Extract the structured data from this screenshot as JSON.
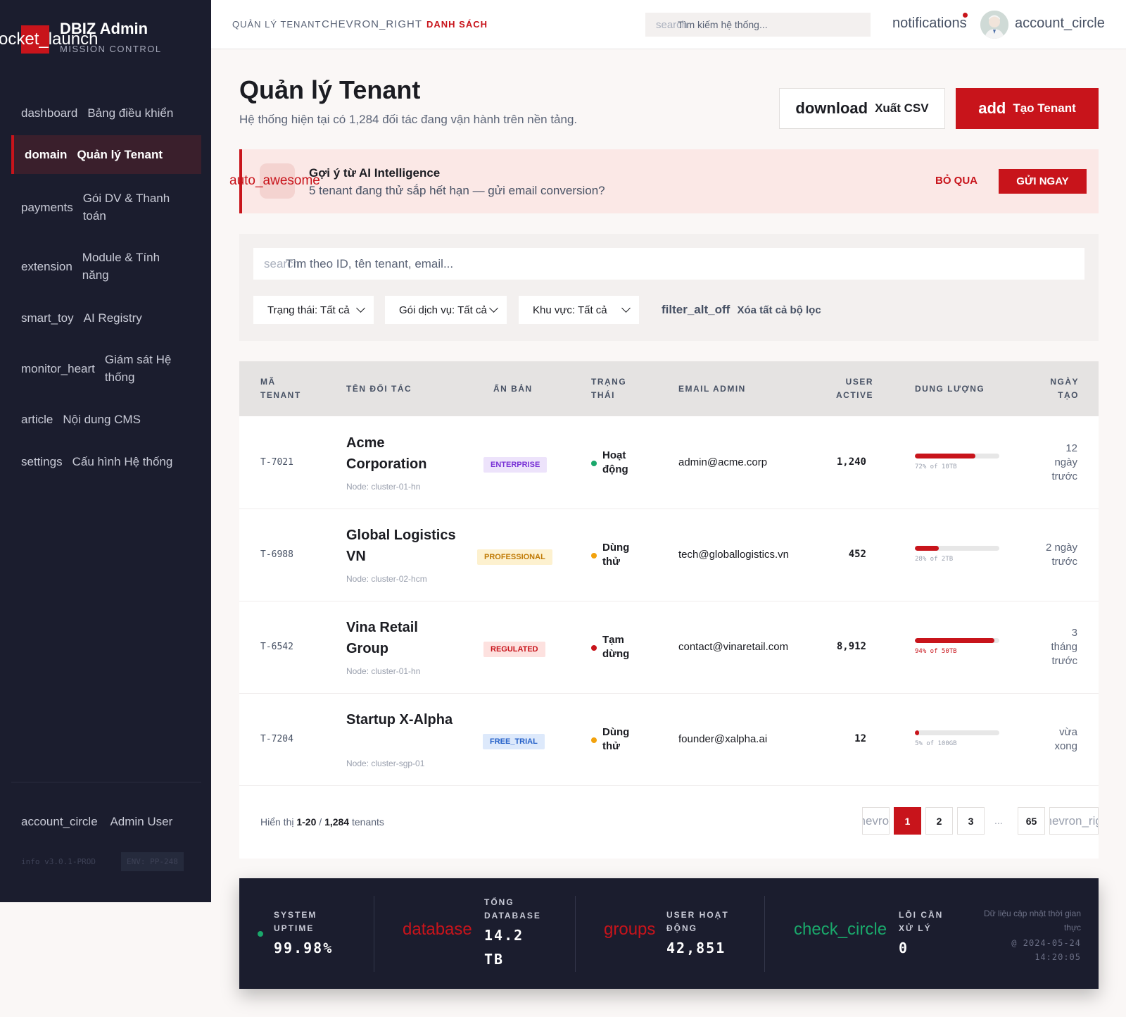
{
  "sidebar": {
    "logo_icon": "rocket_launch",
    "brand_title": "DBIZ Admin",
    "brand_subtitle": "MISSION CONTROL",
    "items": [
      {
        "icon": "dashboard",
        "label": "Bảng điều khiển"
      },
      {
        "icon": "domain",
        "label": "Quản lý Tenant"
      },
      {
        "icon": "payments",
        "label": "Gói DV & Thanh toán"
      },
      {
        "icon": "extension",
        "label": "Module & Tính năng"
      },
      {
        "icon": "smart_toy",
        "label": "AI Registry"
      },
      {
        "icon": "monitor_heart",
        "label": "Giám sát Hệ thống"
      },
      {
        "icon": "article",
        "label": "Nội dung CMS"
      },
      {
        "icon": "settings",
        "label": "Cấu hình Hệ thống"
      }
    ],
    "user_icon": "account_circle",
    "user_label": "Admin User",
    "version": "info v3.0.1-PROD",
    "env": "ENV: PP-248"
  },
  "topbar": {
    "crumb_1": "QUẢN LÝ TENANT",
    "crumb_sep": "CHEVRON_RIGHT",
    "crumb_2": "DANH SÁCH",
    "search_icon": "search",
    "search_placeholder": "Tìm kiếm hệ thống...",
    "notifications_icon": "notifications",
    "account_icon": "account_circle"
  },
  "header": {
    "title": "Quản lý Tenant",
    "subtitle": "Hệ thống hiện tại có 1,284 đối tác đang vận hành trên nền tảng.",
    "export_icon": "download",
    "export_label": "Xuất CSV",
    "add_icon": "add",
    "add_label": "Tạo Tenant"
  },
  "banner": {
    "icon": "auto_awesome",
    "title": "Gợi ý từ AI Intelligence",
    "text": "5 tenant đang thử sắp hết hạn — gửi email conversion?",
    "skip": "BỎ QUA",
    "send": "GỬI NGAY"
  },
  "filters": {
    "search_icon": "search",
    "search_placeholder": "Tìm theo ID, tên tenant, email...",
    "status": "Trạng thái: Tất cả",
    "plan": "Gói dịch vụ: Tất cả",
    "region": "Khu vực: Tất cả",
    "clear_icon": "filter_alt_off",
    "clear_label": "Xóa tất cả bộ lọc"
  },
  "table": {
    "headers": {
      "id_1": "MÃ",
      "id_2": "TENANT",
      "name": "TÊN ĐỐI TÁC",
      "plan": "ẤN BẢN",
      "status_1": "TRẠNG",
      "status_2": "THÁI",
      "email": "EMAIL ADMIN",
      "users_1": "USER",
      "users_2": "ACTIVE",
      "storage": "DUNG LƯỢNG",
      "date_1": "NGÀY",
      "date_2": "TẠO"
    },
    "rows": [
      {
        "id": "T-7021",
        "name": "Acme Corporation",
        "node": "Node: cluster-01-hn",
        "plan": "ENTERPRISE",
        "status": "Hoạt động",
        "status_color": "#1aa86b",
        "email": "admin@acme.corp",
        "users": "1,240",
        "usage": 0.72,
        "storage": "72% of 10TB",
        "date": "12 ngày trước"
      },
      {
        "id": "T-6988",
        "name": "Global Logistics VN",
        "node": "Node: cluster-02-hcm",
        "plan": "PROFESSIONAL",
        "status": "Dùng thử",
        "status_color": "#f2a20d",
        "email": "tech@globallogistics.vn",
        "users": "452",
        "usage": 0.28,
        "storage": "28% of 2TB",
        "date": "2 ngày trước"
      },
      {
        "id": "T-6542",
        "name": "Vina Retail Group",
        "node": "Node: cluster-01-hn",
        "plan": "REGULATED",
        "status": "Tạm dừng",
        "status_color": "#c8141b",
        "email": "contact@vinaretail.com",
        "users": "8,912",
        "usage": 0.94,
        "storage": "94% of 50TB",
        "date": "3 tháng trước"
      },
      {
        "id": "T-7204",
        "name": "Startup X-Alpha",
        "node": "Node: cluster-sgp-01",
        "plan": "FREE_TRIAL",
        "status": "Dùng thử",
        "status_color": "#f2a20d",
        "email": "founder@xalpha.ai",
        "users": "12",
        "usage": 0.05,
        "storage": "5% of 100GB",
        "date": "vừa xong"
      }
    ]
  },
  "pagination": {
    "prefix": "Hiển thị",
    "range": "1-20",
    "sep": "/",
    "total": "1,284",
    "suffix": "tenants",
    "prev_icon": "chevron_left",
    "pages": [
      "1",
      "2",
      "3"
    ],
    "ellipsis": "...",
    "last": "65",
    "next_icon": "chevron_right"
  },
  "stats": {
    "uptime_label": "SYSTEM UPTIME",
    "uptime_value": "99.98%",
    "db_icon": "database",
    "db_label": "TỔNG DATABASE",
    "db_value": "14.2 TB",
    "users_icon": "groups",
    "users_label": "USER HOẠT ĐỘNG",
    "users_value": "42,851",
    "errors_icon": "check_circle",
    "errors_label": "LỖI CẦN XỬ LÝ",
    "errors_value": "0",
    "footnote": "Dữ liệu cập nhật thời gian thực",
    "timestamp": "@ 2024-05-24 14:20:05",
    "colors": {
      "red": "#c8141b",
      "green": "#1aa86b"
    }
  }
}
